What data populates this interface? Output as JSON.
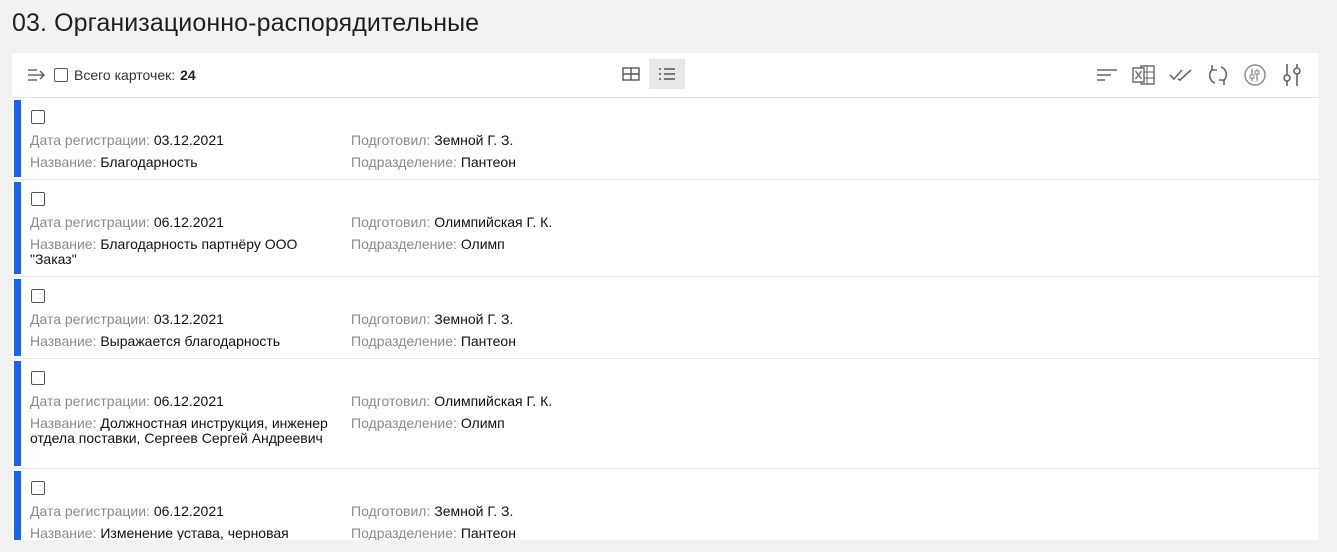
{
  "page_title": "03. Организационно-распорядительные",
  "toolbar": {
    "total_label": "Всего карточек:",
    "total_count": "24",
    "icons": {
      "collapse": "collapse-arrow-icon",
      "grid_view": "grid-view-icon",
      "list_view": "list-view-icon",
      "sort": "sort-icon",
      "excel": "excel-export-icon",
      "check_all": "double-check-icon",
      "refresh": "refresh-icon",
      "settings_toggle": "sliders-toggle-icon",
      "filter": "filter-sliders-icon"
    }
  },
  "labels": {
    "date": "Дата регистрации:",
    "name": "Название:",
    "author": "Подготовил:",
    "department": "Подразделение:"
  },
  "cards": [
    {
      "date": "03.12.2021",
      "name": "Благодарность",
      "author": "Земной Г. З.",
      "department": "Пантеон"
    },
    {
      "date": "06.12.2021",
      "name": "Благодарность партнёру ООО \"Заказ\"",
      "author": "Олимпийская Г. К.",
      "department": "Олимп"
    },
    {
      "date": "03.12.2021",
      "name": "Выражается благодарность",
      "author": "Земной Г. З.",
      "department": "Пантеон"
    },
    {
      "date": "06.12.2021",
      "name": "Должностная инструкция, инженер отдела поставки, Сергеев Сергей Андреевич",
      "author": "Олимпийская Г. К.",
      "department": "Олимп"
    },
    {
      "date": "06.12.2021",
      "name": "Изменение устава, черновая",
      "author": "Земной Г. З.",
      "department": "Пантеон"
    }
  ],
  "colors": {
    "accent_bar": "#1f62e8",
    "background": "#f2f2f2"
  }
}
